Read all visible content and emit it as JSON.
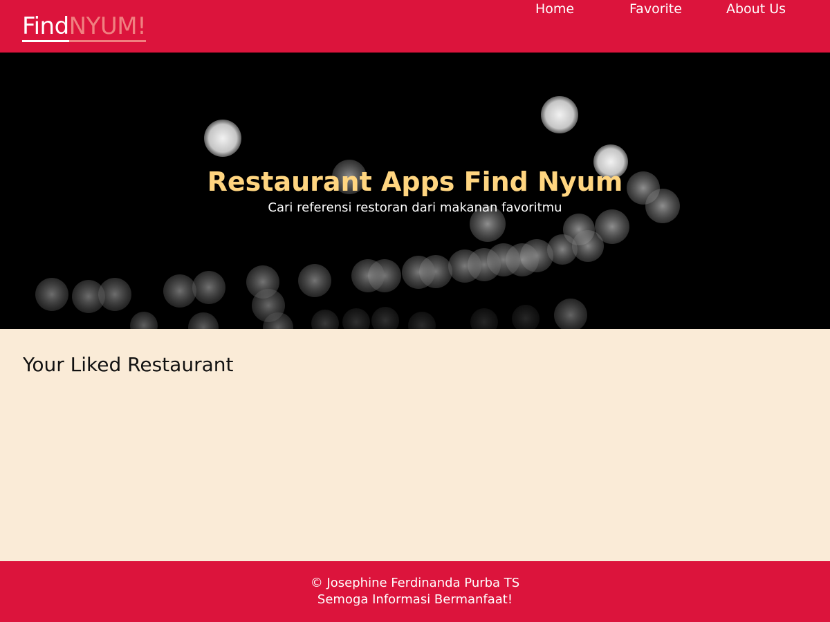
{
  "header": {
    "logo_part1": "Find",
    "logo_part2": "NYUM!",
    "nav": [
      {
        "label": "Home"
      },
      {
        "label": "Favorite"
      },
      {
        "label": "About Us"
      }
    ]
  },
  "hero": {
    "title": "Restaurant Apps Find Nyum",
    "subtitle": "Cari referensi restoran dari makanan favoritmu"
  },
  "main": {
    "title": "Your Liked Restaurant"
  },
  "footer": {
    "copyright": "© Josephine Ferdinanda Purba TS",
    "tagline": "Semoga Informasi Bermanfaat!"
  },
  "colors": {
    "brand": "#dc143c",
    "logo_accent": "#f08080",
    "hero_title": "#ffd580",
    "background": "#faebd7"
  }
}
